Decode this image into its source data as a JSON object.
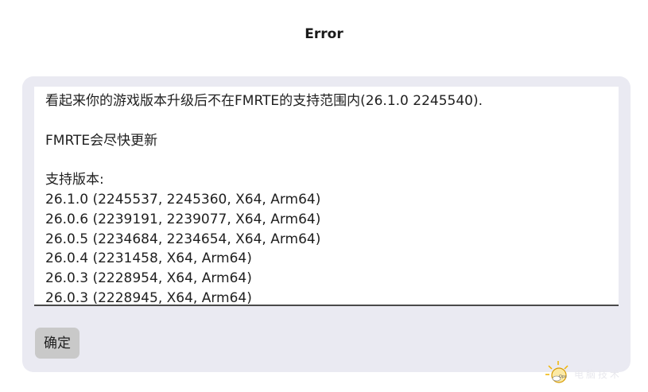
{
  "dialog": {
    "title": "Error",
    "message_lines": [
      "看起来你的游戏版本升级后不在FMRTE的支持范围内(26.1.0 2245540).",
      "",
      "FMRTE会尽快更新",
      "",
      "支持版本:",
      "26.1.0 (2245537, 2245360, X64, Arm64)",
      "26.0.6 (2239191, 2239077, X64, Arm64)",
      "26.0.5 (2234684, 2234654, X64, Arm64)",
      "26.0.4 (2231458, X64, Arm64)",
      "26.0.3 (2228954, X64, Arm64)",
      "26.0.3 (2228945, X64, Arm64)"
    ],
    "ok_label": "确定"
  },
  "watermark": {
    "icon": "bulb-logo-icon",
    "text": "电脑技术"
  },
  "colors": {
    "panel_background": "#eaeaf2",
    "button_background": "#c9c9c9",
    "text": "#1f1f1f"
  }
}
